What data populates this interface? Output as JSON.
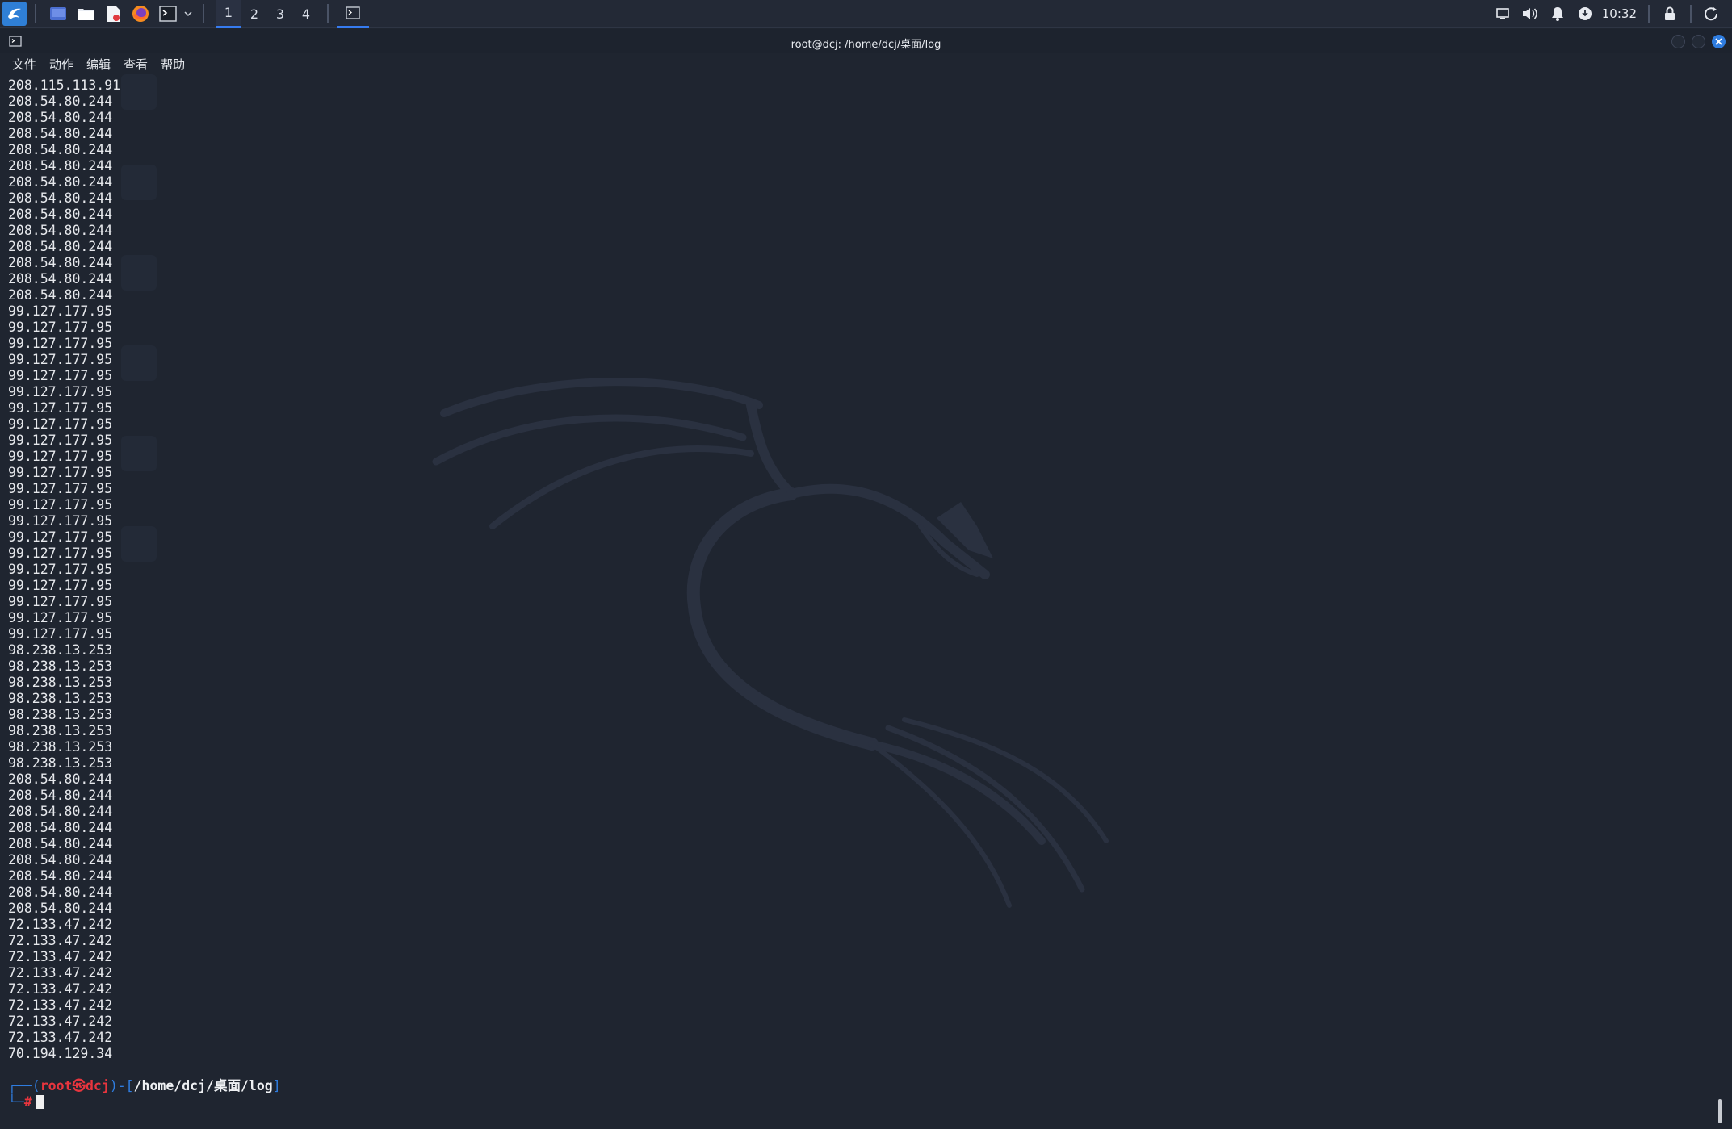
{
  "taskbar": {
    "workspaces": [
      "1",
      "2",
      "3",
      "4"
    ],
    "active_workspace": "1",
    "clock": "10:32",
    "icons": [
      "kali-menu-icon",
      "desktop-icon",
      "file-manager-icon",
      "text-editor-icon",
      "firefox-icon",
      "terminal-icon",
      "dropdown-icon"
    ],
    "tray": [
      "display-icon",
      "volume-icon",
      "notification-bell-icon",
      "network-icon",
      "lock-icon",
      "power-icon"
    ]
  },
  "window": {
    "title": "root@dcj: /home/dcj/桌面/log"
  },
  "menu": [
    "文件",
    "动作",
    "编辑",
    "查看",
    "帮助"
  ],
  "terminal": {
    "lines": [
      "208.115.113.91",
      "208.54.80.244",
      "208.54.80.244",
      "208.54.80.244",
      "208.54.80.244",
      "208.54.80.244",
      "208.54.80.244",
      "208.54.80.244",
      "208.54.80.244",
      "208.54.80.244",
      "208.54.80.244",
      "208.54.80.244",
      "208.54.80.244",
      "208.54.80.244",
      "99.127.177.95",
      "99.127.177.95",
      "99.127.177.95",
      "99.127.177.95",
      "99.127.177.95",
      "99.127.177.95",
      "99.127.177.95",
      "99.127.177.95",
      "99.127.177.95",
      "99.127.177.95",
      "99.127.177.95",
      "99.127.177.95",
      "99.127.177.95",
      "99.127.177.95",
      "99.127.177.95",
      "99.127.177.95",
      "99.127.177.95",
      "99.127.177.95",
      "99.127.177.95",
      "99.127.177.95",
      "99.127.177.95",
      "98.238.13.253",
      "98.238.13.253",
      "98.238.13.253",
      "98.238.13.253",
      "98.238.13.253",
      "98.238.13.253",
      "98.238.13.253",
      "98.238.13.253",
      "208.54.80.244",
      "208.54.80.244",
      "208.54.80.244",
      "208.54.80.244",
      "208.54.80.244",
      "208.54.80.244",
      "208.54.80.244",
      "208.54.80.244",
      "208.54.80.244",
      "72.133.47.242",
      "72.133.47.242",
      "72.133.47.242",
      "72.133.47.242",
      "72.133.47.242",
      "72.133.47.242",
      "72.133.47.242",
      "72.133.47.242",
      "70.194.129.34"
    ],
    "prompt": {
      "open": "┌──(",
      "user": "root",
      "at": "㉿",
      "host": "dcj",
      "mid": ")-[",
      "path": "/home/dcj/桌面/log",
      "close": "]",
      "line2_prefix": "└─",
      "symbol": "#"
    }
  },
  "colors": {
    "accent": "#367bf0",
    "background": "#1f2530",
    "prompt_red": "#e8353e",
    "prompt_blue": "#2f7de0"
  }
}
